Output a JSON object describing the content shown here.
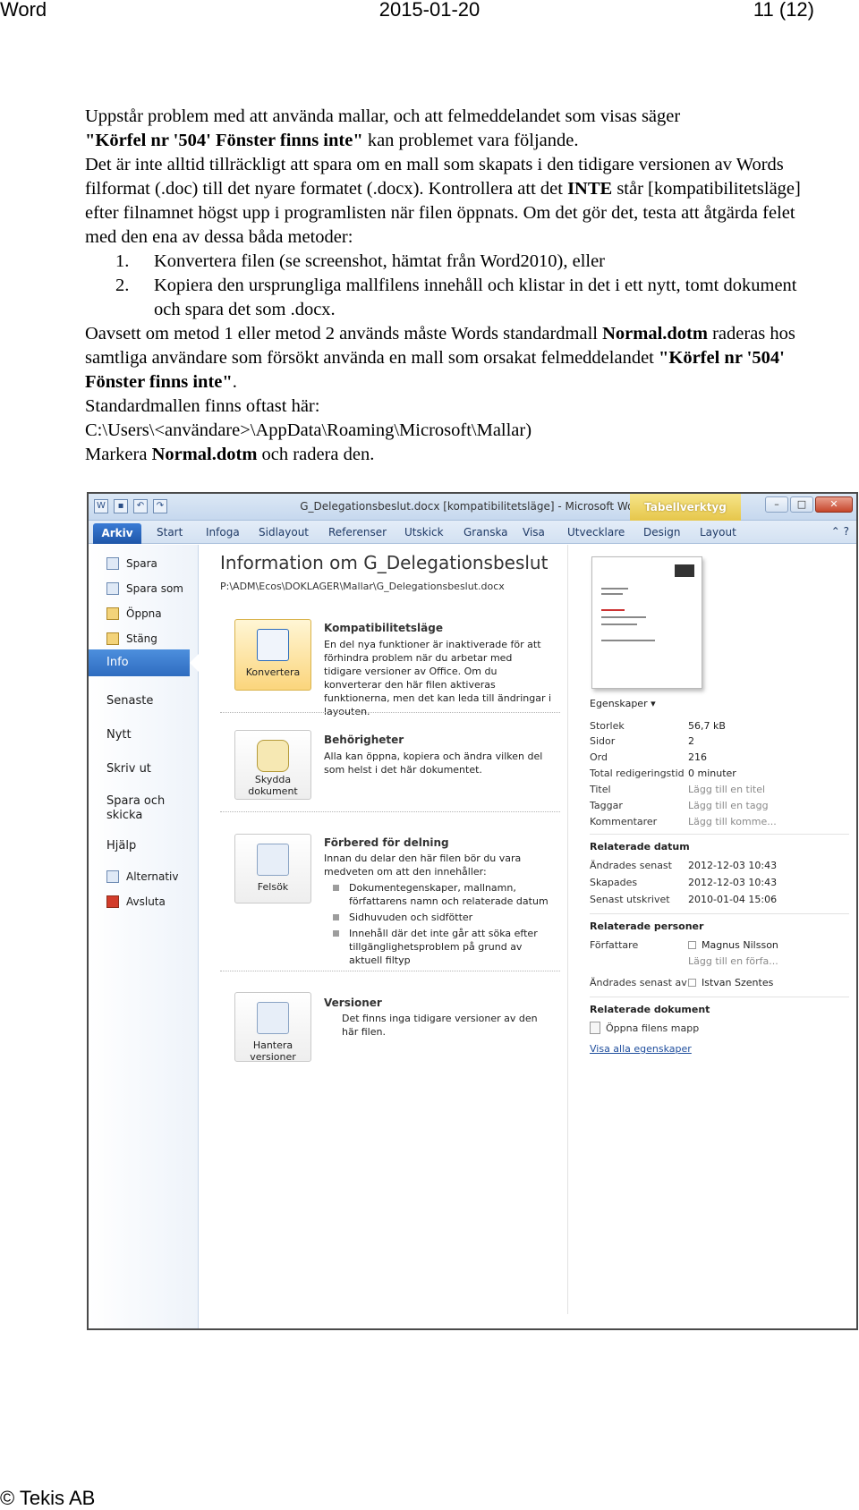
{
  "header": {
    "left": "Word",
    "center": "2015-01-20",
    "right": "11 (12)"
  },
  "body": {
    "p1_a": "Uppstår problem med att använda mallar, och att felmeddelandet som visas säger",
    "p1_b_bold": "\"Körfel nr '504' Fönster finns inte\"",
    "p1_c": " kan problemet vara följande.",
    "p2_a": "Det är inte alltid tillräckligt att spara om en mall som skapats i den tidigare versionen av Words filformat (.doc) till det nyare formatet (.docx). Kontrollera att det ",
    "p2_b_bold": "INTE",
    "p2_c": " står [kompatibilitetsläge] efter filnamnet högst upp i programlisten när filen öppnats. Om det gör det, testa att åtgärda felet med den ena av dessa båda metoder:",
    "list": [
      {
        "num": "1.",
        "text": "Konvertera filen (se screenshot, hämtat från Word2010), eller"
      },
      {
        "num": "2.",
        "text": "Kopiera den ursprungliga mallfilens innehåll och klistar in det i ett nytt, tomt dokument och spara det som .docx."
      }
    ],
    "p3_a": "Oavsett om metod 1 eller metod 2 används måste Words standardmall ",
    "p3_b_bold": "Normal.dotm",
    "p3_c": " raderas hos samtliga användare som försökt använda en mall som orsakat felmeddelandet ",
    "p3_d_bold": "\"Körfel nr '504' Fönster finns inte\"",
    "p3_e": ".",
    "p4": "Standardmallen finns oftast här:",
    "p5": "C:\\Users\\<användare>\\AppData\\Roaming\\Microsoft\\Mallar)",
    "p6_a": "Markera ",
    "p6_b_bold": "Normal.dotm",
    "p6_c": " och radera den."
  },
  "footer": "© Tekis AB",
  "screenshot": {
    "window_title": "G_Delegationsbeslut.docx [kompatibilitetsläge] - Microsoft Word",
    "context_tab": "Tabellverktyg",
    "tabs": [
      "Arkiv",
      "Start",
      "Infoga",
      "Sidlayout",
      "Referenser",
      "Utskick",
      "Granska",
      "Visa",
      "Utvecklare",
      "Design",
      "Layout"
    ],
    "nav": {
      "spara": "Spara",
      "spara_som": "Spara som",
      "oppna": "Öppna",
      "stang": "Stäng",
      "info": "Info",
      "senaste": "Senaste",
      "nytt": "Nytt",
      "skriv_ut": "Skriv ut",
      "spara_och_skicka": "Spara och skicka",
      "hjalp": "Hjälp",
      "alternativ": "Alternativ",
      "avsluta": "Avsluta"
    },
    "info_title": "Information om G_Delegationsbeslut",
    "info_path": "P:\\ADM\\Ecos\\DOKLAGER\\Mallar\\G_Delegationsbeslut.docx",
    "sections": {
      "kompat_btn": "Konvertera",
      "kompat_h": "Kompatibilitetsläge",
      "kompat_t": "En del nya funktioner är inaktiverade för att förhindra problem när du arbetar med tidigare versioner av Office. Om du konverterar den här filen aktiveras funktionerna, men det kan leda till ändringar i layouten.",
      "beh_btn": "Skydda dokument",
      "beh_h": "Behörigheter",
      "beh_t": "Alla kan öppna, kopiera och ändra vilken del som helst i det här dokumentet.",
      "forb_btn": "Felsök",
      "forb_h": "Förbered för delning",
      "forb_t": "Innan du delar den här filen bör du vara medveten om att den innehåller:",
      "forb_b1": "Dokumentegenskaper, mallnamn, författarens namn och relaterade datum",
      "forb_b2": "Sidhuvuden och sidfötter",
      "forb_b3": "Innehåll där det inte går att söka efter tillgänglighetsproblem på grund av aktuell filtyp",
      "vers_btn": "Hantera versioner",
      "vers_h": "Versioner",
      "vers_t": "Det finns inga tidigare versioner av den här filen."
    },
    "props": {
      "header": "Egenskaper ▾",
      "rows": [
        {
          "label": "Storlek",
          "value": "56,7 kB",
          "muted": false
        },
        {
          "label": "Sidor",
          "value": "2",
          "muted": false
        },
        {
          "label": "Ord",
          "value": "216",
          "muted": false
        },
        {
          "label": "Total redigeringstid",
          "value": "0 minuter",
          "muted": false
        },
        {
          "label": "Titel",
          "value": "Lägg till en titel",
          "muted": true
        },
        {
          "label": "Taggar",
          "value": "Lägg till en tagg",
          "muted": true
        },
        {
          "label": "Kommentarer",
          "value": "Lägg till komme...",
          "muted": true
        }
      ],
      "dates_h": "Relaterade datum",
      "dates": [
        {
          "label": "Ändrades senast",
          "value": "2012-12-03 10:43"
        },
        {
          "label": "Skapades",
          "value": "2012-12-03 10:43"
        },
        {
          "label": "Senast utskrivet",
          "value": "2010-01-04 15:06"
        }
      ],
      "people_h": "Relaterade personer",
      "forfattare_label": "Författare",
      "forfattare_value": "Magnus Nilsson",
      "forfattare_add": "Lägg till en förfa...",
      "andrades_av_label": "Ändrades senast av",
      "andrades_av_value": "Istvan Szentes",
      "docs_h": "Relaterade dokument",
      "open_folder": "Öppna filens mapp",
      "show_all": "Visa alla egenskaper"
    }
  }
}
